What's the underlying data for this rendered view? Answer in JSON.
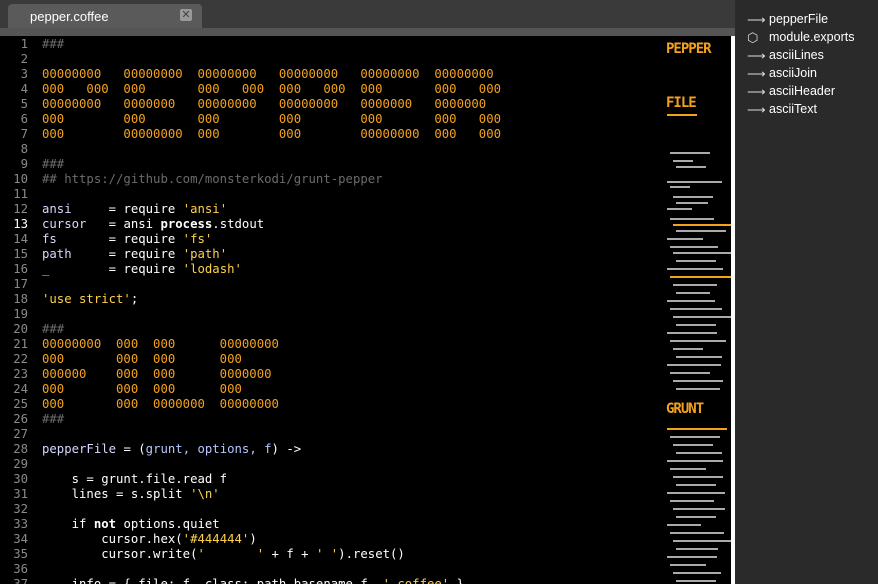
{
  "tab": {
    "title": "pepper.coffee",
    "close_icon": "close-icon"
  },
  "outline": [
    {
      "label": "pepperFile",
      "icon": "arrow-right-icon"
    },
    {
      "label": "module.exports",
      "icon": "cube-icon"
    },
    {
      "label": "asciiLines",
      "icon": "arrow-right-icon"
    },
    {
      "label": "asciiJoin",
      "icon": "arrow-right-icon"
    },
    {
      "label": "asciiHeader",
      "icon": "arrow-right-icon"
    },
    {
      "label": "asciiText",
      "icon": "arrow-right-icon"
    }
  ],
  "editor": {
    "current_line": 13,
    "lines": [
      [
        [
          "c",
          "###"
        ]
      ],
      [],
      [
        [
          "a",
          "00000000   00000000  00000000   00000000   00000000  00000000"
        ]
      ],
      [
        [
          "a",
          "000   000  000       000   000  000   000  000       000   000"
        ]
      ],
      [
        [
          "a",
          "00000000   0000000   00000000   00000000   0000000   0000000"
        ]
      ],
      [
        [
          "a",
          "000        000       000        000        000       000   000"
        ]
      ],
      [
        [
          "a",
          "000        00000000  000        000        00000000  000   000"
        ]
      ],
      [],
      [
        [
          "c",
          "###"
        ]
      ],
      [
        [
          "c",
          "## https://github.com/monsterkodi/grunt-pepper"
        ]
      ],
      [],
      [
        [
          "v",
          "ansi"
        ],
        [
          "",
          "     = require "
        ],
        [
          "s",
          "'ansi'"
        ]
      ],
      [
        [
          "v",
          "cursor"
        ],
        [
          "",
          "   = ansi "
        ],
        [
          "b",
          "process"
        ],
        [
          "",
          ".stdout"
        ]
      ],
      [
        [
          "v",
          "fs"
        ],
        [
          "",
          "       = require "
        ],
        [
          "s",
          "'fs'"
        ]
      ],
      [
        [
          "v",
          "path"
        ],
        [
          "",
          "     = require "
        ],
        [
          "s",
          "'path'"
        ]
      ],
      [
        [
          "v",
          "_"
        ],
        [
          "",
          "        = require "
        ],
        [
          "s",
          "'lodash'"
        ]
      ],
      [],
      [
        [
          "s",
          "'use strict'"
        ],
        [
          "",
          ";"
        ]
      ],
      [],
      [
        [
          "c",
          "###"
        ]
      ],
      [
        [
          "a",
          "00000000  000  000      00000000"
        ]
      ],
      [
        [
          "a",
          "000       000  000      000"
        ]
      ],
      [
        [
          "a",
          "000000    000  000      0000000"
        ]
      ],
      [
        [
          "a",
          "000       000  000      000"
        ]
      ],
      [
        [
          "a",
          "000       000  0000000  00000000"
        ]
      ],
      [
        [
          "c",
          "###"
        ]
      ],
      [],
      [
        [
          "v",
          "pepperFile"
        ],
        [
          "",
          " = ("
        ],
        [
          "p",
          "grunt, options, f"
        ],
        [
          "",
          ") ->"
        ]
      ],
      [],
      [
        [
          "",
          "    s = grunt.file.read f"
        ]
      ],
      [
        [
          "",
          "    lines = s.split "
        ],
        [
          "s",
          "'\\n'"
        ]
      ],
      [],
      [
        [
          "",
          "    if "
        ],
        [
          "b",
          "not"
        ],
        [
          "",
          " options.quiet"
        ]
      ],
      [
        [
          "",
          "        cursor.hex("
        ],
        [
          "s",
          "'#444444'"
        ],
        [
          "",
          ")"
        ]
      ],
      [
        [
          "",
          "        cursor.write("
        ],
        [
          "s",
          "'       '"
        ],
        [
          "",
          " + f + "
        ],
        [
          "s",
          "' '"
        ],
        [
          "",
          ").reset()"
        ]
      ],
      [],
      [
        [
          "",
          "    info = { file: f, class: path.basename f, "
        ],
        [
          "s",
          "'.coffee'"
        ],
        [
          "",
          " }"
        ]
      ]
    ]
  },
  "minimap": {
    "words": [
      {
        "text": "PEPPER"
      },
      {
        "text": "FILE"
      },
      {
        "text": "GRUNT"
      }
    ]
  }
}
